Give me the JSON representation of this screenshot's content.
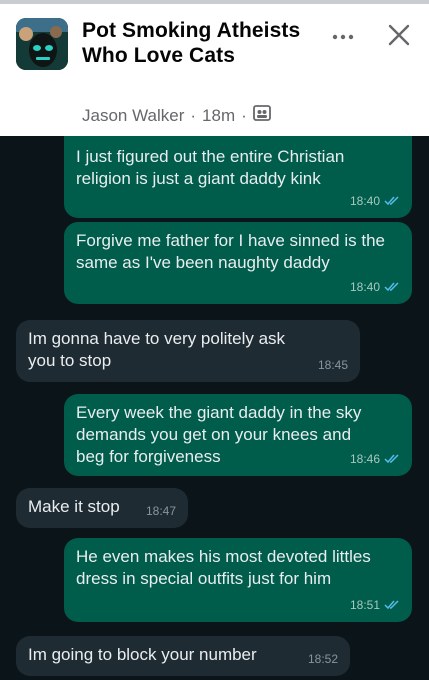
{
  "post": {
    "group_name": "Pot Smoking Atheists Who Love Cats",
    "author": "Jason Walker",
    "time_ago": "18m",
    "separator": "·",
    "more_icon": "more-horizontal-icon",
    "close_icon": "close-icon",
    "audience_icon": "group-audience-icon"
  },
  "messages": [
    {
      "direction": "outgoing",
      "text": "I just figured out the entire Christian religion is just a giant daddy kink",
      "time": "18:40"
    },
    {
      "direction": "outgoing",
      "text": "Forgive me father for I have sinned is the same as I've been naughty daddy",
      "time": "18:40"
    },
    {
      "direction": "incoming",
      "text": "Im gonna have to very politely ask you to stop",
      "time": "18:45"
    },
    {
      "direction": "outgoing",
      "text": "Every week the giant daddy in the sky demands you get on your knees and beg for forgiveness",
      "time": "18:46"
    },
    {
      "direction": "incoming",
      "text": "Make it stop",
      "time": "18:47"
    },
    {
      "direction": "outgoing",
      "text": "He even makes his most devoted littles dress in special outfits just for him",
      "time": "18:51"
    },
    {
      "direction": "incoming",
      "text": "Im going to block your number",
      "time": "18:52"
    }
  ],
  "colors": {
    "chat_background": "#0b1418",
    "outgoing_bubble": "#005c4b",
    "incoming_bubble": "#1f2b32",
    "read_ticks": "#53bdeb"
  }
}
